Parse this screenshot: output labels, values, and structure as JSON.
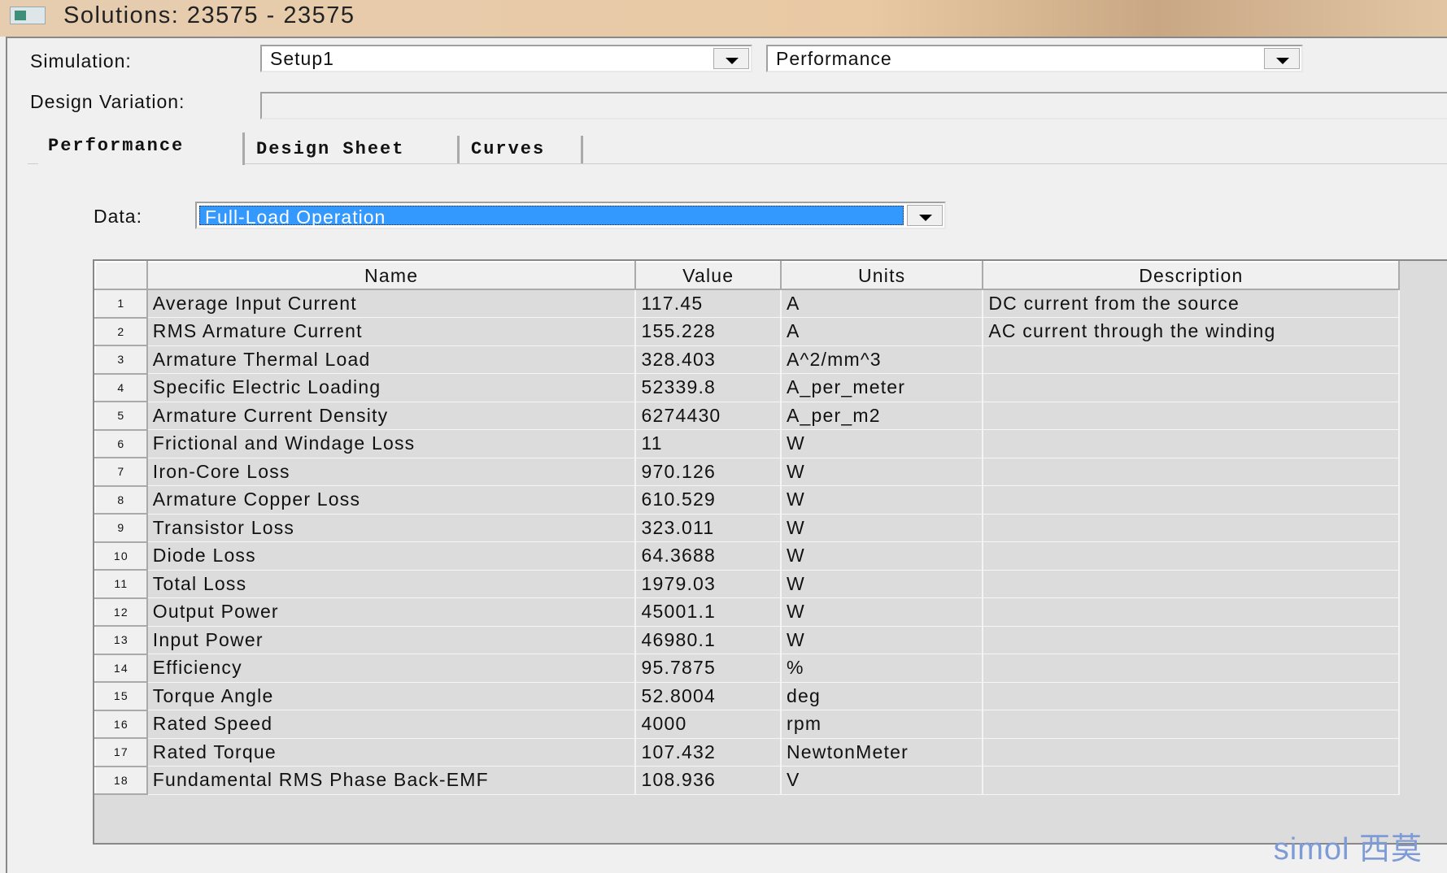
{
  "window": {
    "title": "Solutions: 23575 - 23575"
  },
  "form": {
    "simulation_label": "Simulation:",
    "simulation_value": "Setup1",
    "report_value": "Performance",
    "design_variation_label": "Design Variation:",
    "design_variation_value": "",
    "data_label": "Data:",
    "data_value": "Full-Load Operation"
  },
  "tabs": [
    {
      "label": "Performance",
      "active": true
    },
    {
      "label": "Design Sheet"
    },
    {
      "label": "Curves"
    }
  ],
  "table": {
    "columns": [
      "Name",
      "Value",
      "Units",
      "Description"
    ],
    "rows": [
      [
        "1",
        "Average Input Current",
        "117.45",
        "A",
        "DC current from the source"
      ],
      [
        "2",
        "RMS Armature Current",
        "155.228",
        "A",
        "AC current through the winding"
      ],
      [
        "3",
        "Armature Thermal Load",
        "328.403",
        "A^2/mm^3",
        ""
      ],
      [
        "4",
        "Specific Electric Loading",
        "52339.8",
        "A_per_meter",
        ""
      ],
      [
        "5",
        "Armature Current Density",
        "6274430",
        "A_per_m2",
        ""
      ],
      [
        "6",
        "Frictional and Windage Loss",
        "11",
        "W",
        ""
      ],
      [
        "7",
        "Iron-Core Loss",
        "970.126",
        "W",
        ""
      ],
      [
        "8",
        "Armature Copper Loss",
        "610.529",
        "W",
        ""
      ],
      [
        "9",
        "Transistor Loss",
        "323.011",
        "W",
        ""
      ],
      [
        "10",
        "Diode Loss",
        "64.3688",
        "W",
        ""
      ],
      [
        "11",
        "Total Loss",
        "1979.03",
        "W",
        ""
      ],
      [
        "12",
        "Output Power",
        "45001.1",
        "W",
        ""
      ],
      [
        "13",
        "Input Power",
        "46980.1",
        "W",
        ""
      ],
      [
        "14",
        "Efficiency",
        "95.7875",
        "%",
        ""
      ],
      [
        "15",
        "Torque Angle",
        "52.8004",
        "deg",
        ""
      ],
      [
        "16",
        "Rated Speed",
        "4000",
        "rpm",
        ""
      ],
      [
        "17",
        "Rated Torque",
        "107.432",
        "NewtonMeter",
        ""
      ],
      [
        "18",
        "Fundamental RMS Phase Back-EMF",
        "108.936",
        "V",
        ""
      ]
    ]
  },
  "watermark": "simol 西莫",
  "colors": {
    "selection": "#3399ff",
    "cell_bg": "#dcdcdc",
    "watermark": "#7e9bd6"
  }
}
